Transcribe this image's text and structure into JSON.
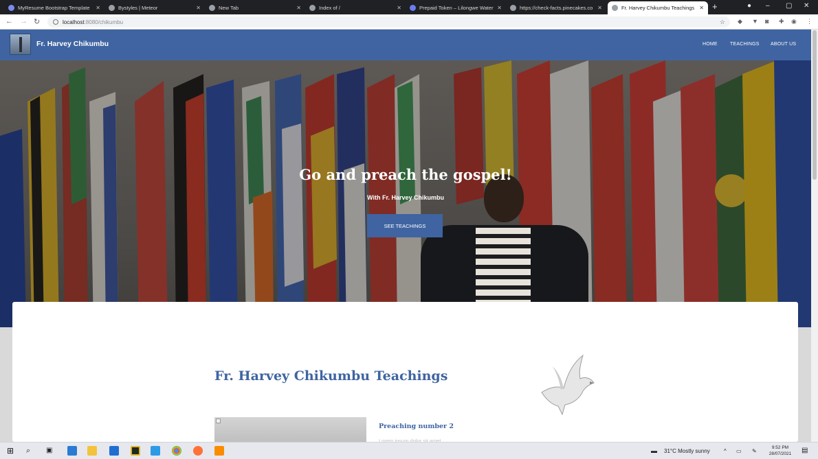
{
  "browser": {
    "tabs": [
      {
        "title": "MyResume Bootstrap Template",
        "active": false
      },
      {
        "title": "Bystyles | Meteor",
        "active": false
      },
      {
        "title": "New Tab",
        "active": false
      },
      {
        "title": "Index of /",
        "active": false
      },
      {
        "title": "Prepaid Token – Lilongwe Water",
        "active": false
      },
      {
        "title": "https://check-facts.pinecakes.co",
        "active": false
      },
      {
        "title": "Fr. Harvey Chikumbu Teachings",
        "active": true
      }
    ],
    "new_tab_icon": "+",
    "window_controls": {
      "minimize": "–",
      "maximize": "▢",
      "close": "✕"
    },
    "address": {
      "host": "localhost",
      "path": ":8080/chikumbu"
    },
    "colors": {
      "tabstrip": "#202124",
      "active_tab": "#ffffff"
    }
  },
  "site": {
    "brand": "Fr. Harvey Chikumbu",
    "nav": [
      "HOME",
      "TEACHINGS",
      "ABOUT US"
    ],
    "hero": {
      "title": "Go and preach the gospel!",
      "subtitle": "With Fr. Harvey Chikumbu",
      "button": "SEE TEACHINGS"
    },
    "section_title": "Fr. Harvey Chikumbu Teachings",
    "post": {
      "title": "Preaching number 2",
      "excerpt": "Lorem ipsum dolor sit amet"
    },
    "colors": {
      "primary": "#3f64a1",
      "card": "#ffffff"
    }
  },
  "taskbar": {
    "weather": "31°C  Mostly sunny",
    "time": "9:52 PM",
    "date": "28/07/2021"
  }
}
